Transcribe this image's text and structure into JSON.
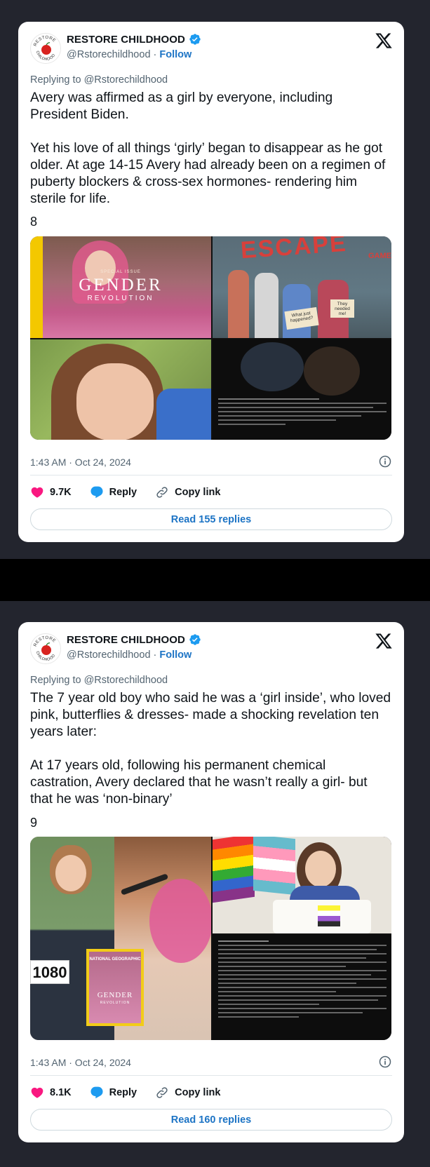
{
  "tweets": [
    {
      "author": {
        "display_name": "RESTORE CHILDHOOD",
        "handle": "@Rstorechildhood",
        "separator": "·",
        "follow_label": "Follow",
        "avatar_text_top": "RESTORE",
        "avatar_text_bottom": "CHILDHOOD"
      },
      "replying_to": "Replying to @Rstorechildhood",
      "text": "Avery was affirmed as a girl by everyone, including President Biden.\n\nYet his love of all things ‘girly’ began to disappear as he got older. At age 14-15 Avery had already been on a regimen of puberty blockers & cross-sex hormones- rendering him sterile for life.",
      "number": "8",
      "media": {
        "tile_1_title": "GENDER",
        "tile_1_subtitle": "REVOLUTION",
        "tile_1_kicker": "SPECIAL ISSUE",
        "tile_2_sign_text": "ESCAPE",
        "tile_2_sign_sub": "GAME",
        "tile_2_card_1": "What just happened?",
        "tile_2_card_2": "They needed me!"
      },
      "timestamp": "1:43 AM · Oct 24, 2024",
      "likes": "9.7K",
      "reply_label": "Reply",
      "copy_label": "Copy link",
      "read_replies": "Read 155 replies"
    },
    {
      "author": {
        "display_name": "RESTORE CHILDHOOD",
        "handle": "@Rstorechildhood",
        "separator": "·",
        "follow_label": "Follow",
        "avatar_text_top": "RESTORE",
        "avatar_text_bottom": "CHILDHOOD"
      },
      "replying_to": "Replying to @Rstorechildhood",
      "text": "The 7 year old boy who said he was a ‘girl inside’, who loved pink, butterflies & dresses- made a shocking revelation ten years later:\n\nAt 17 years old, following his permanent chemical castration, Avery declared that he wasn’t really a girl- but that he was ‘non-binary’",
      "number": "9",
      "media": {
        "bib_number": "1080",
        "magazine_name": "NATIONAL GEOGRAPHIC",
        "magazine_title": "GENDER",
        "magazine_sub": "REVOLUTION"
      },
      "timestamp": "1:43 AM · Oct 24, 2024",
      "likes": "8.1K",
      "reply_label": "Reply",
      "copy_label": "Copy link",
      "read_replies": "Read 160 replies"
    }
  ],
  "colors": {
    "like": "#f91880",
    "reply": "#1d9bf0",
    "link": "#1d74c5",
    "verified": "#1d9bf0",
    "muted": "#536471"
  }
}
